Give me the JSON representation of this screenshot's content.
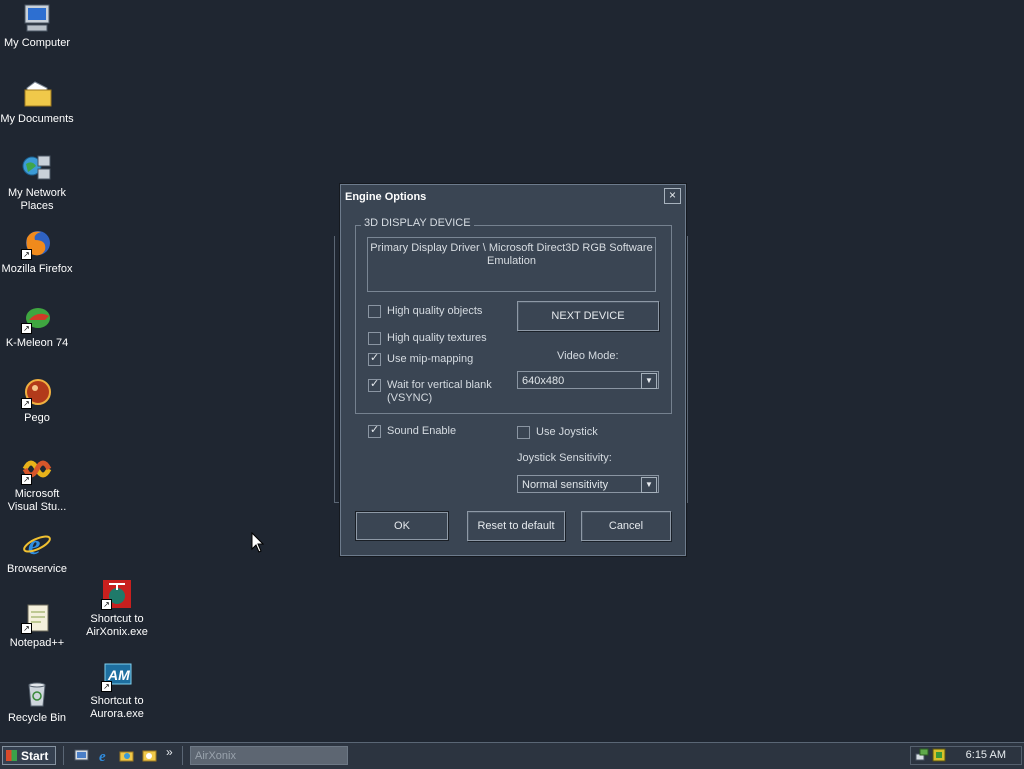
{
  "desktop": {
    "icons": [
      {
        "label": "My Computer",
        "icon": "computer-icon"
      },
      {
        "label": "My Documents",
        "icon": "folder-documents-icon"
      },
      {
        "label": "My Network Places",
        "icon": "network-icon"
      },
      {
        "label": "Mozilla Firefox",
        "icon": "firefox-icon"
      },
      {
        "label": "K-Meleon 74",
        "icon": "k-meleon-icon"
      },
      {
        "label": "Pego",
        "icon": "pego-icon"
      },
      {
        "label": "Microsoft Visual Stu...",
        "icon": "visual-studio-icon"
      },
      {
        "label": "Browservice",
        "icon": "internet-explorer-icon"
      },
      {
        "label": "Notepad++",
        "icon": "notepad-icon"
      },
      {
        "label": "Recycle Bin",
        "icon": "recycle-bin-icon"
      },
      {
        "label": "Shortcut to AirXonix.exe",
        "icon": "airxonix-icon"
      },
      {
        "label": "Shortcut to Aurora.exe",
        "icon": "aurora-icon"
      }
    ]
  },
  "dialog": {
    "title": "Engine Options",
    "close_label": "×",
    "group_label": "3D DISPLAY DEVICE",
    "device_text": "Primary Display Driver \\ Microsoft Direct3D RGB Software Emulation",
    "checkboxes": [
      {
        "label": "High quality objects",
        "checked": false
      },
      {
        "label": "High quality textures",
        "checked": false
      },
      {
        "label": "Use mip-mapping",
        "checked": true
      },
      {
        "label": "Wait for vertical blank (VSYNC)",
        "checked": true
      }
    ],
    "next_device_label": "NEXT DEVICE",
    "video_mode_label": "Video Mode:",
    "video_mode_value": "640x480",
    "sound_enable": {
      "label": "Sound Enable",
      "checked": true
    },
    "use_joystick": {
      "label": "Use Joystick",
      "checked": false
    },
    "joystick_sensitivity_label": "Joystick Sensitivity:",
    "joystick_sensitivity_value": "Normal sensitivity",
    "ok_label": "OK",
    "reset_label": "Reset to default",
    "cancel_label": "Cancel"
  },
  "taskbar": {
    "start_label": "Start",
    "quicklaunch_more": "»",
    "task_label": "AirXonix",
    "clock": "6:15 AM"
  }
}
